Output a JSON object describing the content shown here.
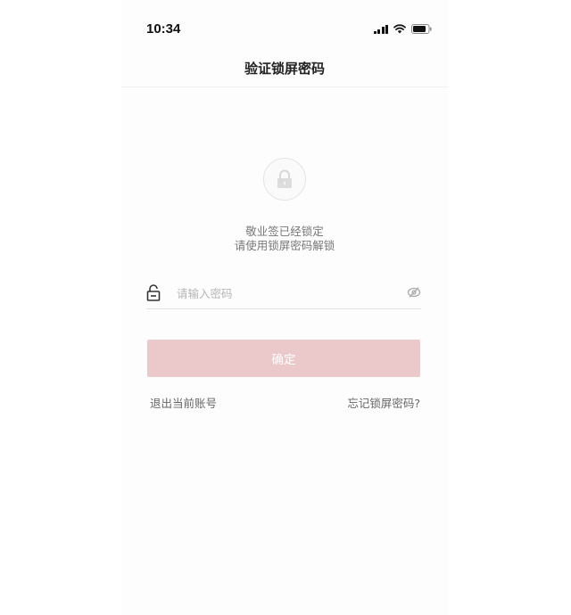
{
  "status_bar": {
    "time": "10:34",
    "icons": [
      "signal-icon",
      "wifi-icon",
      "battery-icon"
    ]
  },
  "nav": {
    "title": "验证锁屏密码"
  },
  "lock_message": {
    "line1": "敬业签已经锁定",
    "line2": "请使用锁屏密码解锁"
  },
  "password_field": {
    "placeholder": "请输入密码",
    "value": ""
  },
  "confirm_button": {
    "label": "确定"
  },
  "links": {
    "logout": "退出当前账号",
    "forgot": "忘记锁屏密码?"
  },
  "colors": {
    "confirm_button_bg": "#ebc9cb",
    "background": "#fdfdfd"
  }
}
